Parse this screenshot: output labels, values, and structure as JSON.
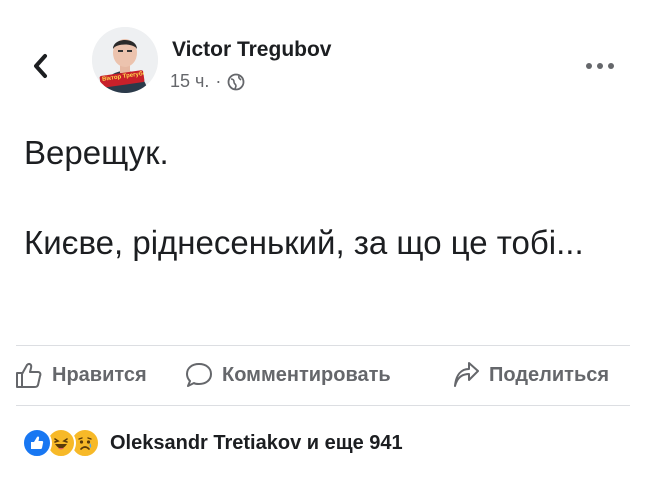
{
  "post": {
    "author": "Victor Tregubov",
    "time": "15 ч.",
    "separator": "·",
    "avatar_badge": "Віктор Трегубов",
    "text": "Верещук.\n\nКиєве, ріднесенький, за що це тобі..."
  },
  "actions": {
    "like_label": "Нравится",
    "comment_label": "Комментировать",
    "share_label": "Поделиться"
  },
  "reactions": {
    "summary": "Oleksandr Tretiakov и еще 941",
    "types": [
      "like",
      "haha",
      "sad"
    ]
  },
  "colors": {
    "text": "#1c1e21",
    "secondary": "#65676b",
    "like_blue": "#1877f2",
    "emoji_yellow": "#f7b928",
    "divider": "#dcdee2"
  },
  "icons": {
    "back": "chevron-left-icon",
    "audience": "globe-icon",
    "more": "more-dots-icon",
    "like": "thumbs-up-icon",
    "comment": "comment-bubble-icon",
    "share": "share-arrow-icon"
  }
}
